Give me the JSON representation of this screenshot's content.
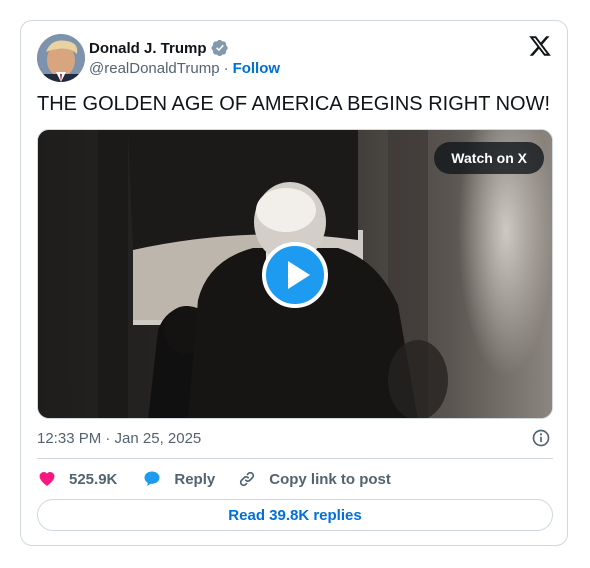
{
  "author": {
    "name": "Donald J. Trump",
    "handle": "@realDonaldTrump",
    "separator": "·",
    "follow_label": "Follow",
    "verified_color": "#829aab"
  },
  "tweet": {
    "text": "THE GOLDEN AGE OF AMERICA BEGINS RIGHT NOW!",
    "timestamp": "12:33 PM · Jan 25, 2025"
  },
  "media": {
    "type": "video",
    "watch_label": "Watch on X",
    "play_color": "#1d9bf0"
  },
  "actions": {
    "like_count": "525.9K",
    "like_color": "#f91880",
    "reply_label": "Reply",
    "reply_color": "#1d9bf0",
    "copy_label": "Copy link to post"
  },
  "footer": {
    "read_replies_label": "Read 39.8K replies"
  },
  "icons": [
    "verified-badge-icon",
    "x-logo-icon",
    "play-icon",
    "info-icon",
    "heart-icon",
    "reply-bubble-icon",
    "link-icon"
  ]
}
